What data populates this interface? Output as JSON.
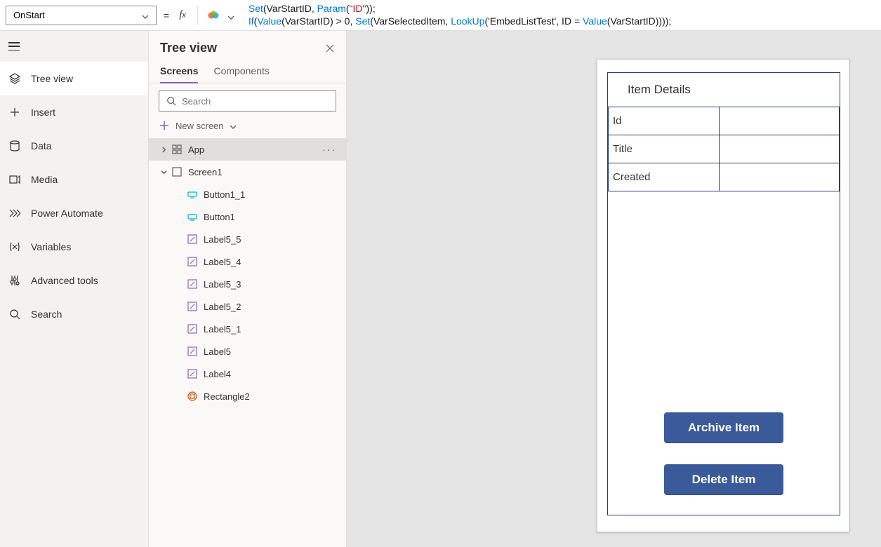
{
  "formula": {
    "property": "OnStart",
    "line1_pre": "Set",
    "line1_mid": "(VarStartID, ",
    "line1_fn2": "Param",
    "line1_arg": "(",
    "line1_str": "\"ID\"",
    "line1_end": "));",
    "line2_pre": "If",
    "line2_a": "(",
    "line2_fn2": "Value",
    "line2_b": "(VarStartID) > 0, ",
    "line2_fn3": "Set",
    "line2_c": "(VarSelectedItem, ",
    "line2_fn4": "LookUp",
    "line2_d": "('EmbedListTest', ID = ",
    "line2_fn5": "Value",
    "line2_e": "(VarStartID))));"
  },
  "rail": {
    "items": [
      {
        "label": "Tree view"
      },
      {
        "label": "Insert"
      },
      {
        "label": "Data"
      },
      {
        "label": "Media"
      },
      {
        "label": "Power Automate"
      },
      {
        "label": "Variables"
      },
      {
        "label": "Advanced tools"
      },
      {
        "label": "Search"
      }
    ]
  },
  "tree": {
    "title": "Tree view",
    "tabs": {
      "screens": "Screens",
      "components": "Components"
    },
    "search_placeholder": "Search",
    "new_screen": "New screen",
    "app": "App",
    "screen": "Screen1",
    "controls": [
      {
        "label": "Button1_1",
        "kind": "button"
      },
      {
        "label": "Button1",
        "kind": "button"
      },
      {
        "label": "Label5_5",
        "kind": "label"
      },
      {
        "label": "Label5_4",
        "kind": "label"
      },
      {
        "label": "Label5_3",
        "kind": "label"
      },
      {
        "label": "Label5_2",
        "kind": "label"
      },
      {
        "label": "Label5_1",
        "kind": "label"
      },
      {
        "label": "Label5",
        "kind": "label"
      },
      {
        "label": "Label4",
        "kind": "label"
      },
      {
        "label": "Rectangle2",
        "kind": "rect"
      }
    ]
  },
  "canvas": {
    "title": "Item Details",
    "rows": [
      {
        "label": "Id",
        "value": ""
      },
      {
        "label": "Title",
        "value": ""
      },
      {
        "label": "Created",
        "value": ""
      }
    ],
    "archive": "Archive Item",
    "delete": "Delete Item"
  }
}
